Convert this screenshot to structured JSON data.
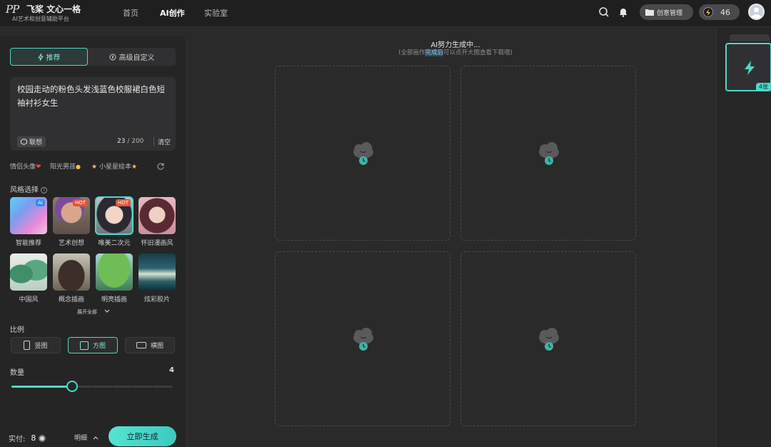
{
  "header": {
    "logo_mark": "PP",
    "logo_name": "飞桨 文心一格",
    "logo_sub": "AI艺术和创意辅助平台",
    "nav": [
      "首页",
      "AI创作",
      "实验室"
    ],
    "create_manage_label": "创意管理",
    "credits": "46",
    "icons": [
      "search-icon",
      "bell-icon",
      "folder-icon",
      "bolt-icon",
      "user-avatar"
    ]
  },
  "left": {
    "mode_tabs": [
      "推荐",
      "高级自定义"
    ],
    "active_mode": "推荐",
    "prompt_text": "校园走动的粉色头发浅蓝色校服裙白色短袖衬衫女生",
    "associate_label": "联想",
    "char_count": "23",
    "char_limit": "/ 200",
    "clear_label": "清空",
    "tags": [
      {
        "label": "情侣头像",
        "emoji": "❤"
      },
      {
        "label": "阳光男孩",
        "emoji": "🌞"
      },
      {
        "label": "小星星绘本",
        "emoji": "★",
        "prefix": "★"
      }
    ],
    "style_label": "风格选择",
    "styles": [
      {
        "name": "智能推荐",
        "badge": "AI",
        "selected": false
      },
      {
        "name": "艺术创想",
        "badge": "HOT",
        "selected": false
      },
      {
        "name": "唯美二次元",
        "badge": "HOT",
        "selected": true
      },
      {
        "name": "怀旧漫画风",
        "badge": "",
        "selected": false
      },
      {
        "name": "中国风",
        "badge": "",
        "selected": false
      },
      {
        "name": "概念插画",
        "badge": "",
        "selected": false
      },
      {
        "name": "明亮插画",
        "badge": "",
        "selected": false
      },
      {
        "name": "炫彩胶片",
        "badge": "",
        "selected": false
      }
    ],
    "expand_label": "展开全部",
    "ratio_label": "比例",
    "ratios": [
      {
        "name": "竖图",
        "selected": false
      },
      {
        "name": "方图",
        "selected": true
      },
      {
        "name": "横图",
        "selected": false
      }
    ],
    "quantity_label": "数量",
    "quantity_value": "4",
    "quantity_fraction": 0.375,
    "pay_label": "实付:",
    "pay_value": "8",
    "detail_label": "明细",
    "generate_label": "立即生成"
  },
  "main": {
    "status_title": "AI努力生成中...",
    "status_sub_pre": "(全部画作",
    "status_sub_hl": "完成后",
    "status_sub_post": "可以点开大图查看下载哦)",
    "tiles": [
      "loading",
      "loading",
      "loading",
      "loading"
    ]
  },
  "right": {
    "history_count": "4张"
  },
  "colors": {
    "accent": "#4fd8c6",
    "background": "#2a2a2b",
    "hot_badge": "#e3533a",
    "ai_badge": "#2f8be8"
  }
}
